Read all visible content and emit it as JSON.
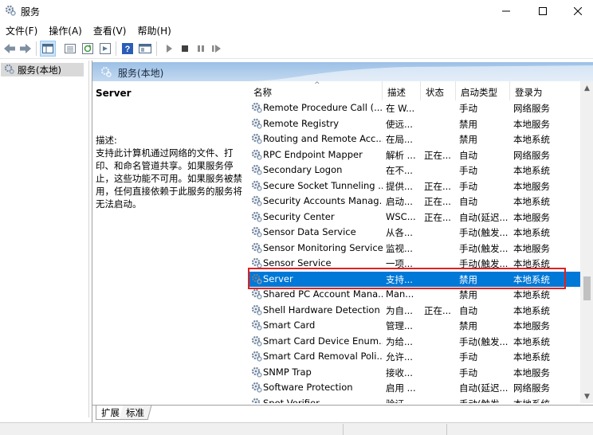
{
  "window": {
    "title": "服务",
    "minimize": "—",
    "maximize": "☐",
    "close": "✕"
  },
  "menu": [
    {
      "label": "文件(F)"
    },
    {
      "label": "操作(A)"
    },
    {
      "label": "查看(V)"
    },
    {
      "label": "帮助(H)"
    }
  ],
  "tree": {
    "item_label": "服务(本地)"
  },
  "panel": {
    "title": "服务(本地)"
  },
  "description_pane": {
    "service_name": "Server",
    "label": "描述:",
    "text": "支持此计算机通过网络的文件、打印、和命名管道共享。如果服务停止，这些功能不可用。如果服务被禁用，任何直接依赖于此服务的服务将无法启动。"
  },
  "list": {
    "columns": [
      "名称",
      "描述",
      "状态",
      "启动类型",
      "登录为"
    ],
    "sort_indicator": "^",
    "rows": [
      {
        "name": "Remote Procedure Call (...",
        "desc": "在 W...",
        "status": "",
        "startup": "手动",
        "logon": "网络服务"
      },
      {
        "name": "Remote Registry",
        "desc": "使远...",
        "status": "",
        "startup": "禁用",
        "logon": "本地服务"
      },
      {
        "name": "Routing and Remote Acc...",
        "desc": "在局...",
        "status": "",
        "startup": "禁用",
        "logon": "本地系统"
      },
      {
        "name": "RPC Endpoint Mapper",
        "desc": "解析 ...",
        "status": "正在...",
        "startup": "自动",
        "logon": "网络服务"
      },
      {
        "name": "Secondary Logon",
        "desc": "在不...",
        "status": "",
        "startup": "手动",
        "logon": "本地系统"
      },
      {
        "name": "Secure Socket Tunneling ...",
        "desc": "提供...",
        "status": "正在...",
        "startup": "手动",
        "logon": "本地服务"
      },
      {
        "name": "Security Accounts Manag...",
        "desc": "启动...",
        "status": "正在...",
        "startup": "自动",
        "logon": "本地系统"
      },
      {
        "name": "Security Center",
        "desc": "WSC...",
        "status": "正在...",
        "startup": "自动(延迟...",
        "logon": "本地服务"
      },
      {
        "name": "Sensor Data Service",
        "desc": "从各...",
        "status": "",
        "startup": "手动(触发...",
        "logon": "本地系统"
      },
      {
        "name": "Sensor Monitoring Service",
        "desc": "监视...",
        "status": "",
        "startup": "手动(触发...",
        "logon": "本地服务"
      },
      {
        "name": "Sensor Service",
        "desc": "一项...",
        "status": "",
        "startup": "手动(触发...",
        "logon": "本地系统"
      },
      {
        "name": "Server",
        "desc": "支持...",
        "status": "",
        "startup": "禁用",
        "logon": "本地系统",
        "selected": true
      },
      {
        "name": "Shared PC Account Mana...",
        "desc": "Man...",
        "status": "",
        "startup": "禁用",
        "logon": "本地系统"
      },
      {
        "name": "Shell Hardware Detection",
        "desc": "为自...",
        "status": "正在...",
        "startup": "自动",
        "logon": "本地系统"
      },
      {
        "name": "Smart Card",
        "desc": "管理...",
        "status": "",
        "startup": "禁用",
        "logon": "本地服务"
      },
      {
        "name": "Smart Card Device Enum...",
        "desc": "为给...",
        "status": "",
        "startup": "手动(触发...",
        "logon": "本地系统"
      },
      {
        "name": "Smart Card Removal Poli...",
        "desc": "允许...",
        "status": "",
        "startup": "手动",
        "logon": "本地系统"
      },
      {
        "name": "SNMP Trap",
        "desc": "接收...",
        "status": "",
        "startup": "手动",
        "logon": "本地服务"
      },
      {
        "name": "Software Protection",
        "desc": "启用 ...",
        "status": "",
        "startup": "自动(延迟...",
        "logon": "网络服务"
      },
      {
        "name": "Spot Verifier",
        "desc": "验证...",
        "status": "",
        "startup": "手动(触发...",
        "logon": "本地系统"
      }
    ]
  },
  "tabs": [
    {
      "label": "扩展"
    },
    {
      "label": "标准"
    }
  ],
  "colors": {
    "selection": "#0078d7",
    "highlight_box": "#e02020",
    "header_gradient": "#9cc0e6"
  }
}
